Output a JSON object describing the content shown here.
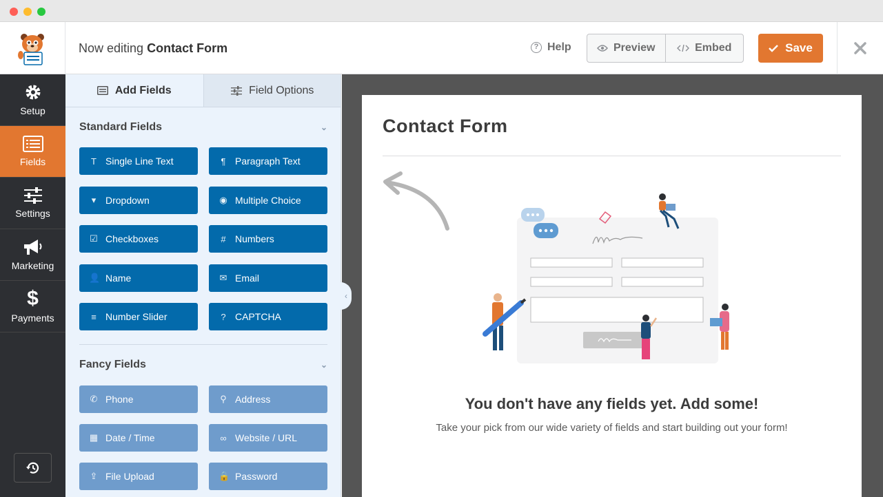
{
  "header": {
    "title_prefix": "Now editing",
    "form_name": "Contact Form",
    "help_label": "Help",
    "preview_label": "Preview",
    "embed_label": "Embed",
    "save_label": "Save"
  },
  "sidebar": {
    "items": [
      {
        "label": "Setup",
        "icon": "gear-icon"
      },
      {
        "label": "Fields",
        "icon": "fields-icon",
        "active": true
      },
      {
        "label": "Settings",
        "icon": "sliders-icon"
      },
      {
        "label": "Marketing",
        "icon": "megaphone-icon"
      },
      {
        "label": "Payments",
        "icon": "dollar-icon"
      }
    ]
  },
  "panel": {
    "tabs": [
      {
        "label": "Add Fields",
        "active": true
      },
      {
        "label": "Field Options",
        "active": false
      }
    ],
    "standard_title": "Standard Fields",
    "standard_fields": [
      {
        "label": "Single Line Text",
        "icon": "T"
      },
      {
        "label": "Paragraph Text",
        "icon": "¶"
      },
      {
        "label": "Dropdown",
        "icon": "▾"
      },
      {
        "label": "Multiple Choice",
        "icon": "◉"
      },
      {
        "label": "Checkboxes",
        "icon": "☑"
      },
      {
        "label": "Numbers",
        "icon": "#"
      },
      {
        "label": "Name",
        "icon": "👤"
      },
      {
        "label": "Email",
        "icon": "✉"
      },
      {
        "label": "Number Slider",
        "icon": "≡"
      },
      {
        "label": "CAPTCHA",
        "icon": "?"
      }
    ],
    "fancy_title": "Fancy Fields",
    "fancy_fields": [
      {
        "label": "Phone",
        "icon": "✆"
      },
      {
        "label": "Address",
        "icon": "⚲"
      },
      {
        "label": "Date / Time",
        "icon": "▦"
      },
      {
        "label": "Website / URL",
        "icon": "∞"
      },
      {
        "label": "File Upload",
        "icon": "⇪"
      },
      {
        "label": "Password",
        "icon": "🔒"
      }
    ]
  },
  "preview": {
    "form_title": "Contact Form",
    "empty_heading": "You don't have any fields yet. Add some!",
    "empty_sub": "Take your pick from our wide variety of fields and start building out your form!"
  },
  "colors": {
    "accent": "#e27730",
    "field_button": "#036aab",
    "fancy_button": "#6f9ccc",
    "sidebar": "#2d2f33",
    "panel": "#ebf3fc"
  }
}
